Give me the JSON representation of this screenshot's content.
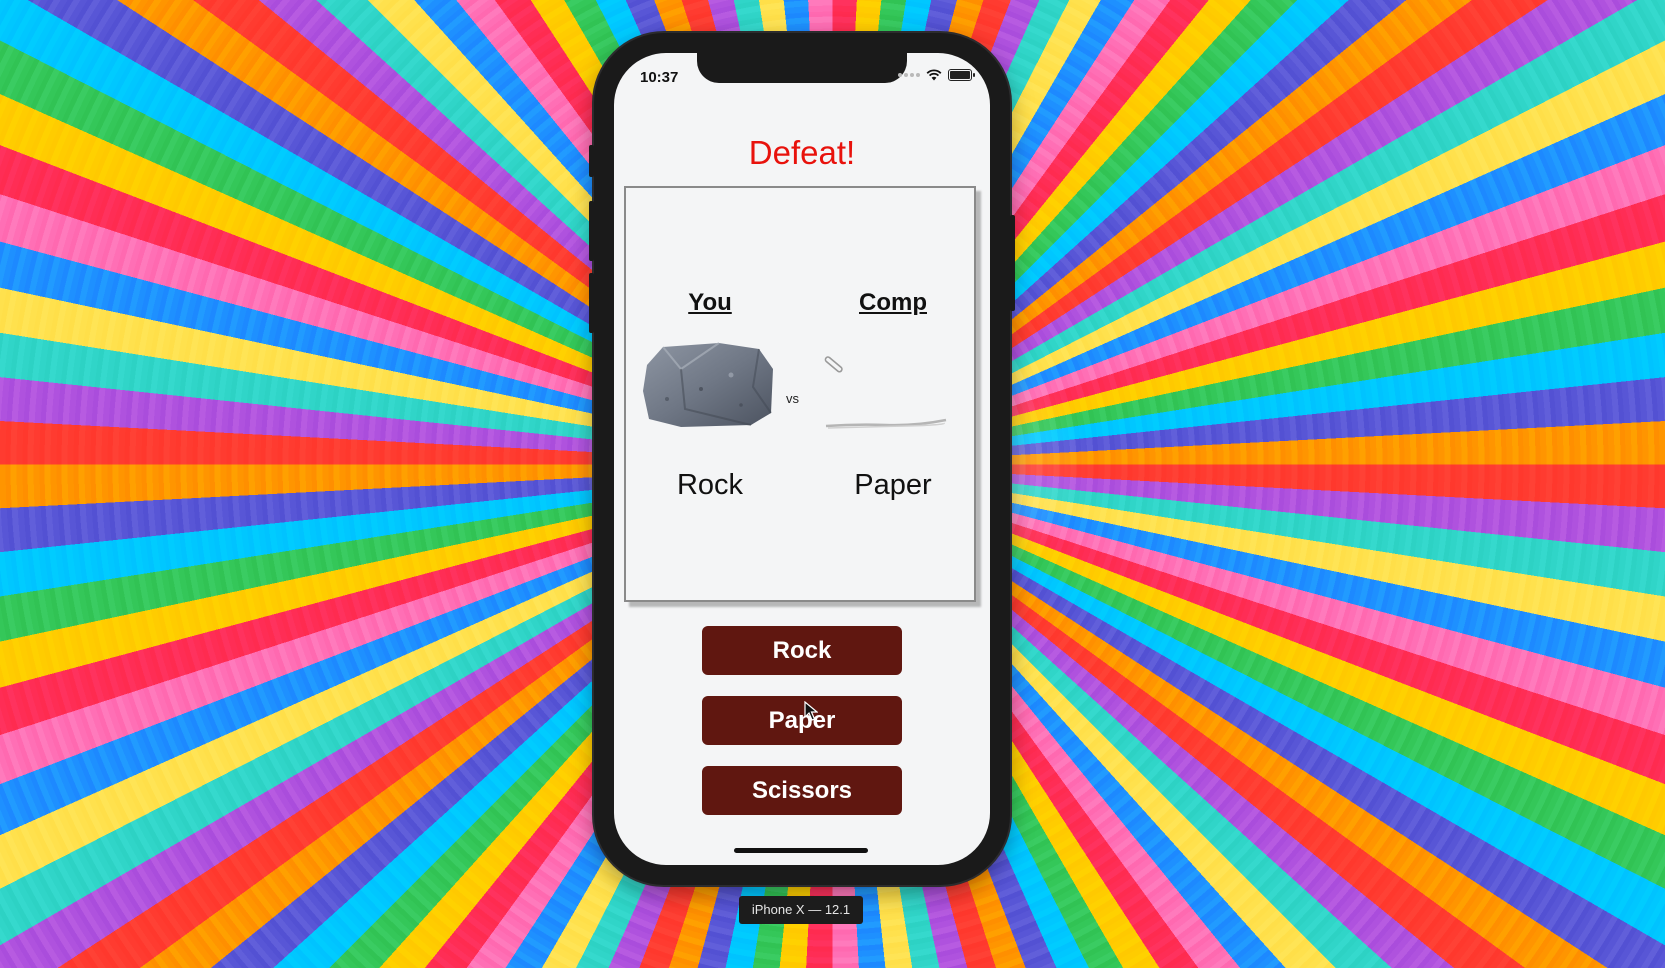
{
  "status_bar": {
    "time": "10:37"
  },
  "game": {
    "result": "Defeat!",
    "you_label": "You",
    "comp_label": "Comp",
    "vs": "vs",
    "you_choice": "Rock",
    "comp_choice": "Paper"
  },
  "buttons": {
    "rock": "Rock",
    "paper": "Paper",
    "scissors": "Scissors"
  },
  "simulator": {
    "device_label": "iPhone X — 12.1"
  },
  "colors": {
    "result_text": "#e8120c",
    "button_bg": "#601710",
    "screen_bg": "#f4f5f6"
  },
  "icons": [
    "wifi-icon",
    "battery-icon",
    "signal-dots-icon",
    "rock-image",
    "paper-image",
    "mouse-cursor-icon"
  ]
}
